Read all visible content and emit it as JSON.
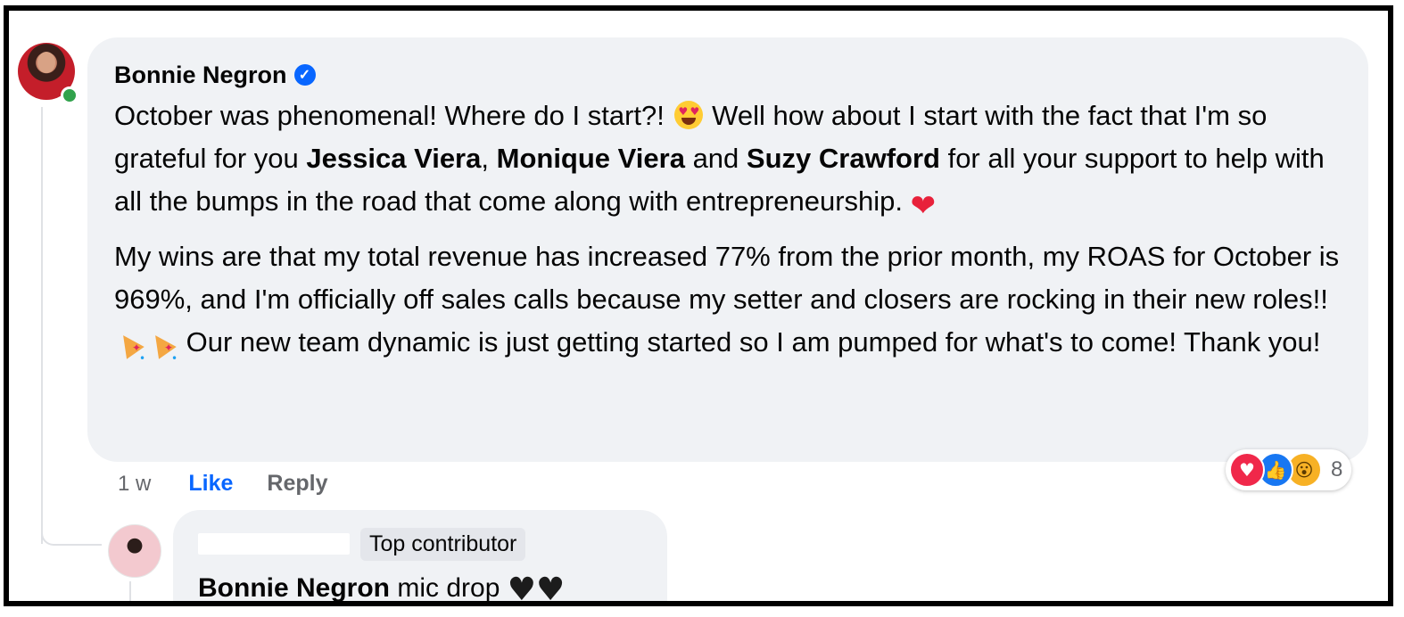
{
  "comment": {
    "author": "Bonnie Negron",
    "paragraph1": {
      "t1": "October was phenomenal! Where do I start?!",
      "t2": "Well how about I start with the fact that I'm so grateful for you",
      "m1": "Jessica Viera",
      "t3": ",",
      "m2": "Monique Viera",
      "t4": "and",
      "m3": "Suzy Crawford",
      "t5": "for all your support to help with all the bumps in the road that come along with entrepreneurship."
    },
    "paragraph2": {
      "t1": "My wins are that my total revenue has increased 77% from the prior month, my ROAS for October is 969%, and I'm officially off sales calls because my setter and closers are rocking in their new roles!!",
      "t2": "Our new team dynamic is just getting started so I am pumped for what's to come! Thank you!"
    },
    "time": "1 w",
    "like_label": "Like",
    "reply_label": "Reply",
    "reaction_count": "8",
    "reaction_icons": [
      "love-icon",
      "like-icon",
      "wow-icon"
    ]
  },
  "reply": {
    "badge": "Top contributor",
    "mention": "Bonnie Negron",
    "text": "mic drop"
  },
  "colors": {
    "bubble": "#f0f2f5",
    "link_blue": "#0866ff",
    "muted": "#65676b",
    "online": "#31a24c"
  }
}
